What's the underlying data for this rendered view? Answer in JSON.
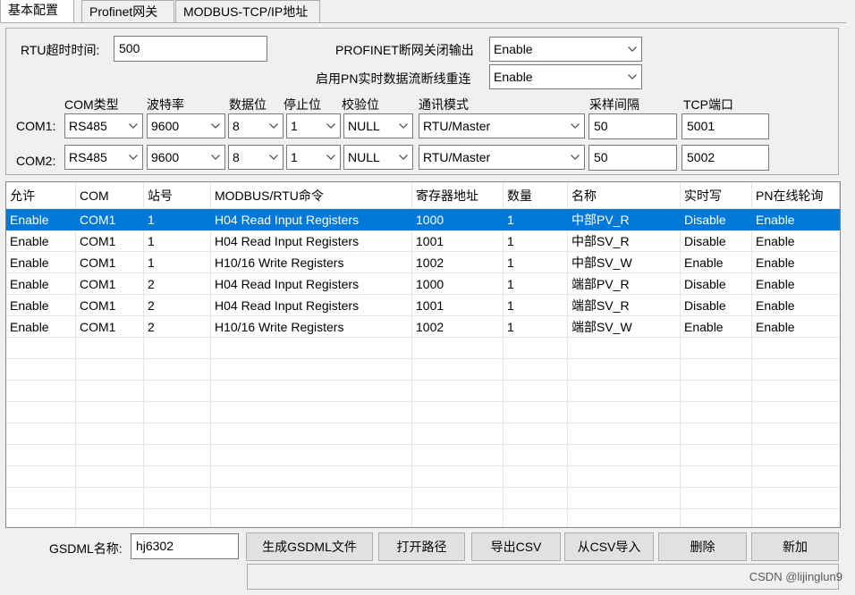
{
  "tabs": [
    {
      "label": "基本配置"
    },
    {
      "label": "Profinet网关"
    },
    {
      "label": "MODBUS-TCP/IP地址"
    }
  ],
  "config": {
    "rtu_timeout_label": "RTU超时时间:",
    "rtu_timeout_value": "500",
    "pn_close_output_label": "PROFINET断网关闭输出",
    "pn_close_output_value": "Enable",
    "pn_reconnect_label": "启用PN实时数据流断线重连",
    "pn_reconnect_value": "Enable"
  },
  "com_headers": {
    "com_type": "COM类型",
    "baud": "波特率",
    "data_bits": "数据位",
    "stop_bits": "停止位",
    "parity": "校验位",
    "mode": "通讯模式",
    "interval": "采样间隔",
    "tcp_port": "TCP端口"
  },
  "com_rows": [
    {
      "label": "COM1:",
      "com_type": "RS485",
      "baud": "9600",
      "data_bits": "8",
      "stop_bits": "1",
      "parity": "NULL",
      "mode": "RTU/Master",
      "interval": "50",
      "tcp_port": "5001"
    },
    {
      "label": "COM2:",
      "com_type": "RS485",
      "baud": "9600",
      "data_bits": "8",
      "stop_bits": "1",
      "parity": "NULL",
      "mode": "RTU/Master",
      "interval": "50",
      "tcp_port": "5002"
    }
  ],
  "grid": {
    "columns": [
      "允许",
      "COM",
      "站号",
      "MODBUS/RTU命令",
      "寄存器地址",
      "数量",
      "名称",
      "实时写",
      "PN在线轮询"
    ],
    "rows": [
      [
        "Enable",
        "COM1",
        "1",
        "H04 Read Input Registers",
        "1000",
        "1",
        "中部PV_R",
        "Disable",
        "Enable"
      ],
      [
        "Enable",
        "COM1",
        "1",
        "H04 Read Input Registers",
        "1001",
        "1",
        "中部SV_R",
        "Disable",
        "Enable"
      ],
      [
        "Enable",
        "COM1",
        "1",
        "H10/16 Write Registers",
        "1002",
        "1",
        "中部SV_W",
        "Enable",
        "Enable"
      ],
      [
        "Enable",
        "COM1",
        "2",
        "H04 Read Input Registers",
        "1000",
        "1",
        "端部PV_R",
        "Disable",
        "Enable"
      ],
      [
        "Enable",
        "COM1",
        "2",
        "H04 Read Input Registers",
        "1001",
        "1",
        "端部SV_R",
        "Disable",
        "Enable"
      ],
      [
        "Enable",
        "COM1",
        "2",
        "H10/16 Write Registers",
        "1002",
        "1",
        "端部SV_W",
        "Enable",
        "Enable"
      ]
    ]
  },
  "bottom": {
    "gsdml_label": "GSDML名称:",
    "gsdml_value": "hj6302",
    "btn_generate": "生成GSDML文件",
    "btn_open_path": "打开路径",
    "btn_export_csv": "导出CSV",
    "btn_import_csv": "从CSV导入",
    "btn_delete": "删除",
    "btn_add": "新加"
  },
  "watermark": "CSDN @lijinglun9",
  "colors": {
    "selection": "#0078d7",
    "window_bg": "#f0f0f0"
  }
}
